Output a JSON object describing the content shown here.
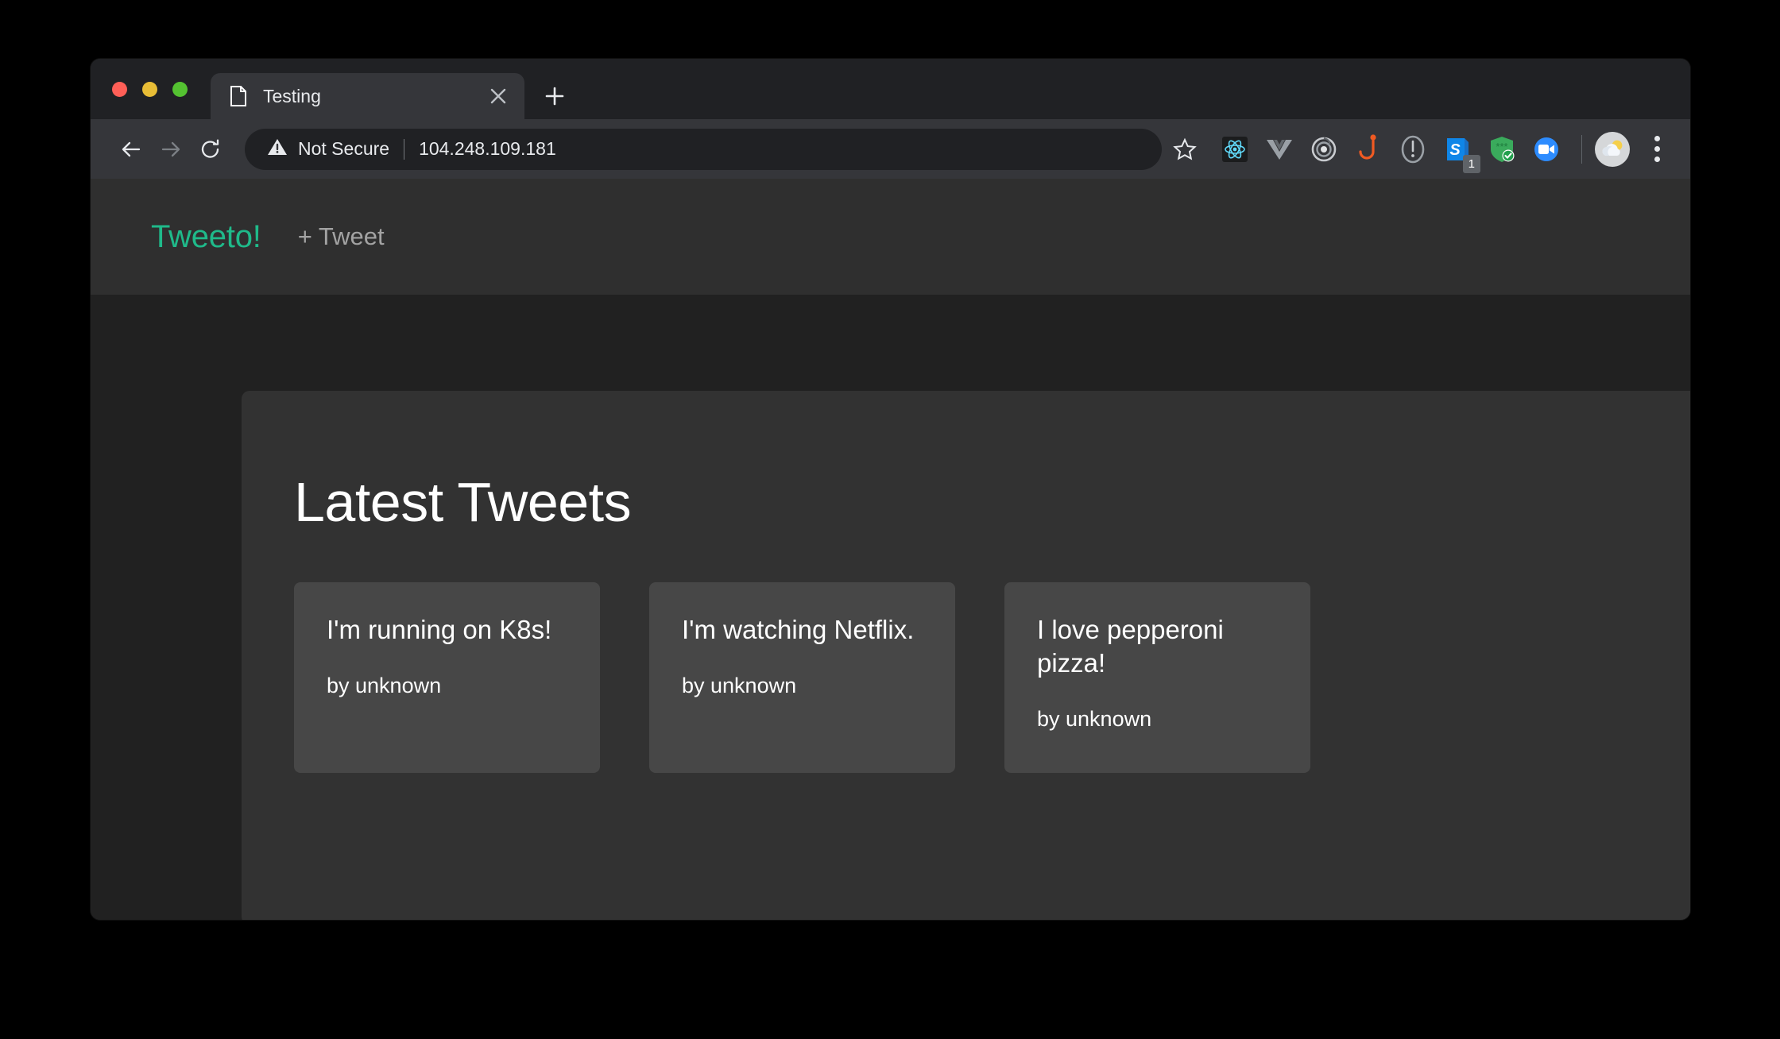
{
  "browser": {
    "tab": {
      "title": "Testing",
      "favicon_icon": "document-icon",
      "close_icon": "close-icon"
    },
    "new_tab_icon": "plus-icon",
    "window_controls": [
      {
        "name": "close",
        "color": "#ff5f57"
      },
      {
        "name": "minimize",
        "color": "#e8bd36"
      },
      {
        "name": "maximize",
        "color": "#54c231"
      }
    ],
    "toolbar": {
      "back_icon": "back-arrow-icon",
      "forward_icon": "forward-arrow-icon",
      "reload_icon": "reload-icon",
      "security_warning_icon": "warning-triangle-icon",
      "security_label": "Not Secure",
      "url": "104.248.109.181",
      "bookmark_icon": "star-outline-icon",
      "menu_icon": "three-dots-vertical-icon",
      "avatar_icon": "partly-cloudy-avatar-icon",
      "extensions": [
        {
          "name": "react-devtools-icon",
          "badge": ""
        },
        {
          "name": "vue-devtools-icon",
          "badge": ""
        },
        {
          "name": "target-rings-icon",
          "badge": ""
        },
        {
          "name": "orange-hook-icon",
          "badge": ""
        },
        {
          "name": "exclamation-circle-icon",
          "badge": ""
        },
        {
          "name": "sketch-s-icon",
          "badge": "1"
        },
        {
          "name": "green-shield-check-icon",
          "badge": ""
        },
        {
          "name": "zoom-camera-icon",
          "badge": ""
        }
      ]
    }
  },
  "site": {
    "brand": "Tweeto!",
    "nav_link": "+ Tweet",
    "brand_color": "#1fba8a",
    "page_title": "Latest Tweets",
    "tweets": [
      {
        "text": "I'm running on K8s!",
        "author": "by unknown"
      },
      {
        "text": "I'm watching Netflix.",
        "author": "by unknown"
      },
      {
        "text": "I love pepperoni pizza!",
        "author": "by unknown"
      }
    ]
  }
}
